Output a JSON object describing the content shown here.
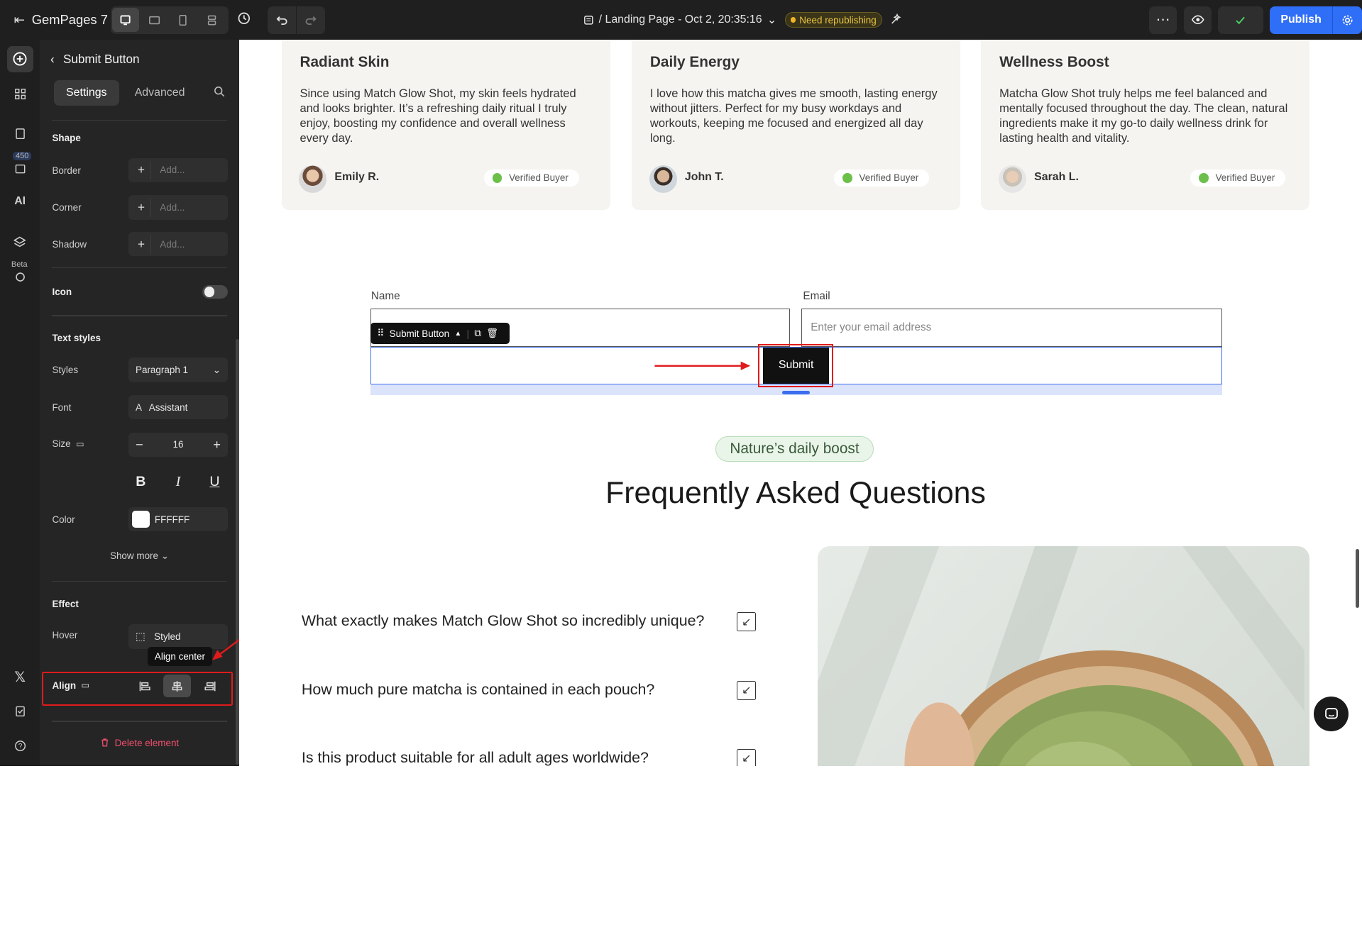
{
  "app": {
    "name": "GemPages 7"
  },
  "topbar": {
    "page_title": "/ Landing Page - Oct 2, 20:35:16",
    "status_badge": "Need republishing",
    "publish_label": "Publish",
    "colors": {
      "publish": "#2f6ef7",
      "badge": "#f0b429"
    }
  },
  "rail": {
    "badge_count": "450",
    "beta_label": "Beta"
  },
  "panel": {
    "title": "Submit Button",
    "tabs": [
      "Settings",
      "Advanced"
    ],
    "shape_section": "Shape",
    "border_label": "Border",
    "corner_label": "Corner",
    "shadow_label": "Shadow",
    "add_placeholder": "Add...",
    "icon_label": "Icon",
    "text_styles_section": "Text styles",
    "styles_label": "Styles",
    "styles_value": "Paragraph 1",
    "font_label": "Font",
    "font_value": "Assistant",
    "font_glyph": "A",
    "size_label": "Size",
    "size_value": "16",
    "color_label": "Color",
    "color_value": "FFFFFF",
    "show_more": "Show more",
    "effect_section": "Effect",
    "hover_label": "Hover",
    "hover_value": "Styled",
    "align_label": "Align",
    "align_tooltip": "Align center",
    "delete_label": "Delete element"
  },
  "testimonials": [
    {
      "title": "Radiant Skin",
      "text": "Since using Match Glow Shot, my skin feels hydrated and looks brighter. It’s a refreshing daily ritual I truly enjoy, boosting my confidence and overall wellness every day.",
      "name": "Emily R.",
      "badge": "Verified Buyer"
    },
    {
      "title": "Daily Energy",
      "text": "I love how this matcha gives me smooth, lasting energy without jitters. Perfect for my busy workdays and workouts, keeping me focused and energized all day long.",
      "name": "John T.",
      "badge": "Verified Buyer"
    },
    {
      "title": "Wellness Boost",
      "text": "Matcha Glow Shot truly helps me feel balanced and mentally focused throughout the day. The clean, natural ingredients make it my go-to daily wellness drink for lasting health and vitality.",
      "name": "Sarah L.",
      "badge": "Verified Buyer"
    }
  ],
  "form": {
    "name_label": "Name",
    "email_label": "Email",
    "email_placeholder": "Enter your email address",
    "toolbar_label": "Submit Button",
    "submit_label": "Submit"
  },
  "faq": {
    "pill": "Nature’s daily boost",
    "title": "Frequently Asked Questions",
    "questions": [
      "What exactly makes Match Glow Shot so incredibly unique?",
      "How much pure matcha is contained in each pouch?",
      "Is this product suitable for all adult ages worldwide?"
    ]
  }
}
